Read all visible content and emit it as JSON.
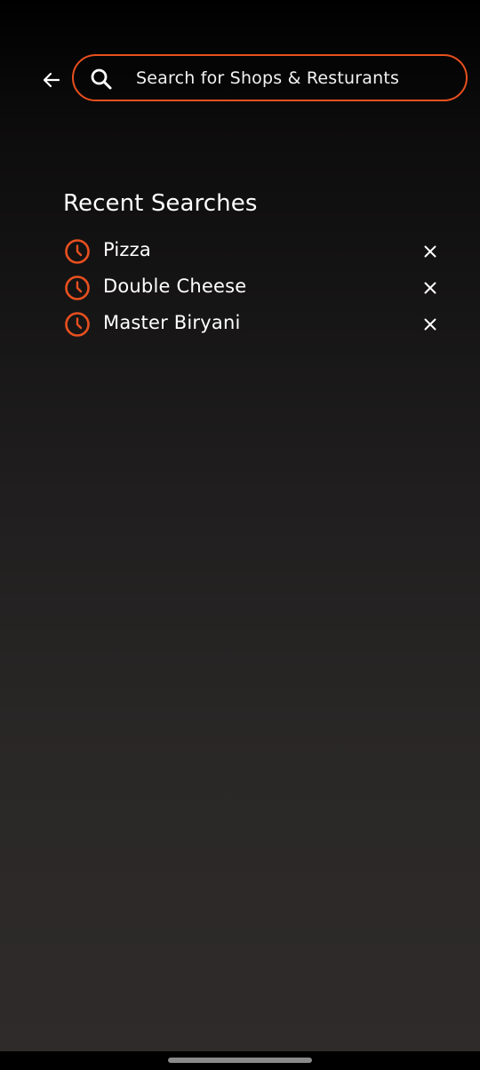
{
  "header": {
    "back_icon": "arrow-left-icon",
    "search": {
      "icon": "search-icon",
      "value": "",
      "placeholder": "Search for Shops & Resturants"
    }
  },
  "recent": {
    "title": "Recent Searches",
    "items": [
      {
        "label": "Pizza",
        "icon": "clock-icon",
        "remove_icon": "close-icon"
      },
      {
        "label": "Double Cheese",
        "icon": "clock-icon",
        "remove_icon": "close-icon"
      },
      {
        "label": "Master Biryani",
        "icon": "clock-icon",
        "remove_icon": "close-icon"
      }
    ]
  },
  "colors": {
    "accent": "#e8501f",
    "text": "#ffffff",
    "background_top": "#000000",
    "background_bottom": "#2e2b2a"
  }
}
